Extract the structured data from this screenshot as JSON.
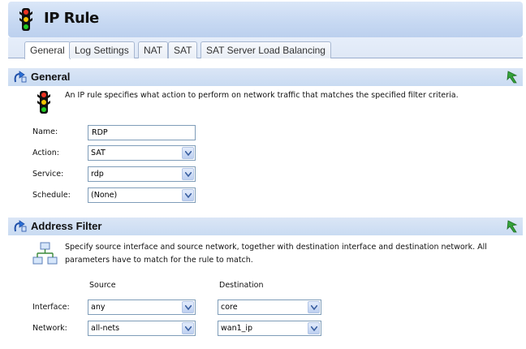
{
  "window": {
    "title": "IP Rule"
  },
  "tabs": [
    {
      "label": "General"
    },
    {
      "label": "Log Settings"
    },
    {
      "label": "NAT"
    },
    {
      "label": "SAT"
    },
    {
      "label": "SAT Server Load Balancing"
    }
  ],
  "general": {
    "header": "General",
    "description": "An IP rule specifies what action to perform on network traffic that matches the specified filter criteria.",
    "fields": {
      "name": {
        "label": "Name:",
        "value": "RDP"
      },
      "action": {
        "label": "Action:",
        "value": "SAT"
      },
      "service": {
        "label": "Service:",
        "value": "rdp"
      },
      "schedule": {
        "label": "Schedule:",
        "value": "(None)"
      }
    }
  },
  "address_filter": {
    "header": "Address Filter",
    "description_line1": "Specify source interface and source network, together with destination interface and destination network. All",
    "description_line2": "parameters have to match for the rule to match.",
    "columns": {
      "source": "Source",
      "destination": "Destination"
    },
    "interface": {
      "label": "Interface:",
      "source": "any",
      "destination": "core"
    },
    "network": {
      "label": "Network:",
      "source": "all-nets",
      "destination": "wan1_ip"
    }
  },
  "icons": {
    "title": "traffic-light-icon",
    "section_arrow": "arrow-right-icon",
    "refresh": "green-refresh-icon",
    "network": "network-icon"
  }
}
